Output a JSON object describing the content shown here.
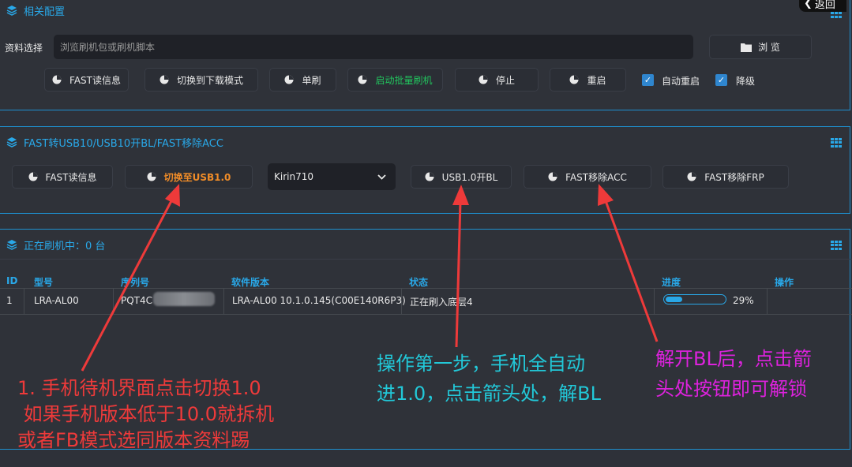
{
  "config": {
    "title": "相关配置",
    "source_label": "资料选择",
    "source_placeholder": "浏览刷机包或刷机脚本",
    "browse_label": "浏 览",
    "buttons": [
      "FAST读信息",
      "切换到下载模式",
      "单刷",
      "启动批量刷机",
      "停止",
      "重启"
    ],
    "auto_reboot_label": "自动重启",
    "downgrade_label": "降级",
    "back_label": "返回"
  },
  "fast": {
    "title": "FAST转USB10/USB10开BL/FAST移除ACC",
    "btn_read": "FAST读信息",
    "btn_switch": "切换至USB1.0",
    "chip_select": "Kirin710",
    "btn_usb_bl": "USB1.0开BL",
    "btn_remove_acc": "FAST移除ACC",
    "btn_remove_frp": "FAST移除FRP"
  },
  "flashing": {
    "title": "正在刷机中：0 台",
    "columns": [
      "ID",
      "型号",
      "序列号",
      "软件版本",
      "状态",
      "进度",
      "操作"
    ],
    "row": {
      "id": "1",
      "model": "LRA-AL00",
      "serial": "PQT4C",
      "version": "LRA-AL00 10.1.0.145(C00E140R6P3)",
      "status": "正在刷入底层4",
      "progress_text": "29%",
      "progress": 0.29
    }
  },
  "annotations": {
    "red": [
      "1. 手机待机界面点击切换1.0",
      " 如果手机版本低于10.0就拆机",
      "或者FB模式选同版本资料踢"
    ],
    "cyan": [
      "操作第一步，手机全自动",
      "进1.0，点击箭头处，解BL"
    ],
    "magenta": [
      "解开BL后，点击箭",
      "头处按钮即可解锁"
    ]
  },
  "colors": {
    "accent": "#29a8e8",
    "green_text": "#22c55e",
    "orange_text": "#f08c28",
    "arrow_red": "#ee3a3a",
    "annot_red": "#ee3a3a",
    "annot_cyan": "#22c8d8",
    "annot_magenta": "#dd22dd"
  }
}
